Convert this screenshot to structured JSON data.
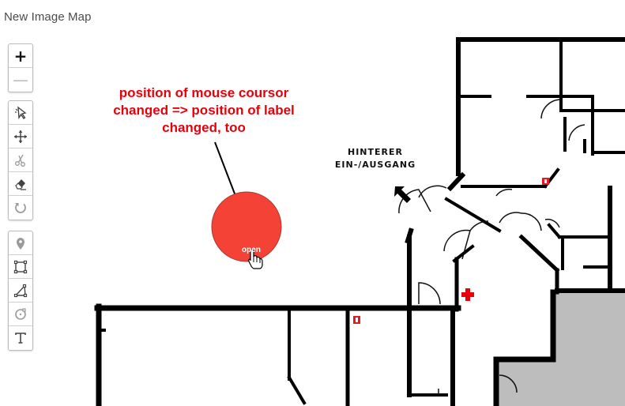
{
  "app": {
    "title": "New Image Map"
  },
  "toolbar": {
    "zoom": [
      {
        "name": "zoom-in-button",
        "icon": "plus-icon",
        "glyph": "+"
      },
      {
        "name": "zoom-out-button",
        "icon": "minus-icon",
        "glyph": "—"
      }
    ],
    "edit_tools": [
      {
        "name": "select-tool-button",
        "icon": "select-cursor-icon"
      },
      {
        "name": "move-tool-button",
        "icon": "move-arrows-icon"
      },
      {
        "name": "cut-tool-button",
        "icon": "scissors-icon"
      },
      {
        "name": "erase-tool-button",
        "icon": "eraser-icon"
      },
      {
        "name": "rotate-tool-button",
        "icon": "rotate-icon"
      }
    ],
    "draw_tools": [
      {
        "name": "marker-tool-button",
        "icon": "map-pin-icon"
      },
      {
        "name": "rectangle-tool-button",
        "icon": "rectangle-icon"
      },
      {
        "name": "polygon-tool-button",
        "icon": "polygon-icon"
      },
      {
        "name": "circle-tool-button",
        "icon": "circle-icon"
      },
      {
        "name": "text-tool-button",
        "icon": "text-icon"
      }
    ]
  },
  "annotation": {
    "line1": "position of mouse coursor",
    "line2": "changed => position of label",
    "line3": "changed, too"
  },
  "floorplan": {
    "sign_line1": "HINTERER",
    "sign_line2": "EIN-/AUSGANG"
  },
  "marker": {
    "label": "open",
    "color": "#f44336"
  },
  "colors": {
    "annotation_text": "#e8000b",
    "wall": "#000000",
    "shaded_area": "#bdbdbd",
    "first_aid_cross": "#e8000b",
    "extinguisher_sign": "#e31b23"
  }
}
